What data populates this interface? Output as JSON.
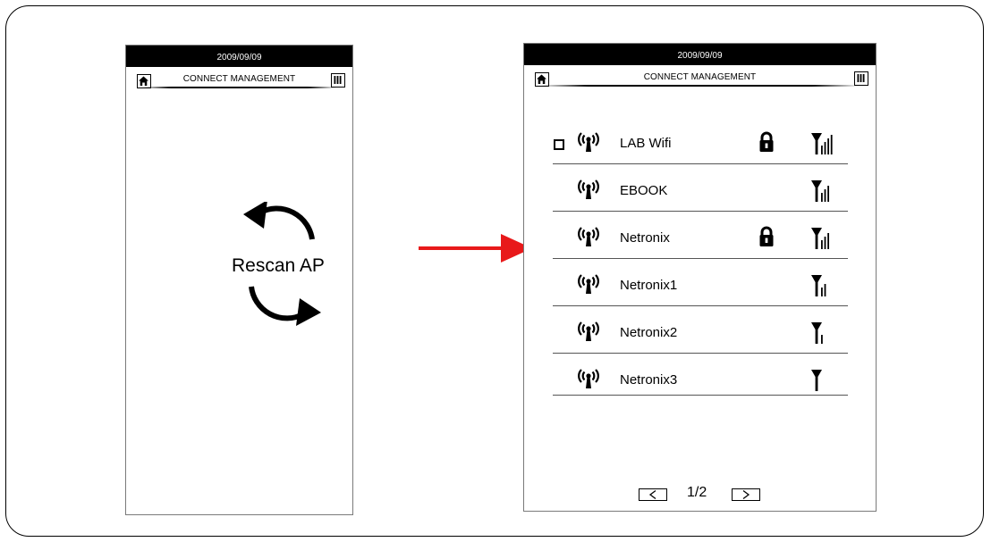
{
  "left_screen": {
    "status": {
      "date": "2009/09/09"
    },
    "header": {
      "title": "CONNECT MANAGEMENT"
    },
    "rescan_label": "Rescan AP",
    "icons": {
      "home": "home-icon",
      "menu": "menu-icon",
      "rescan": "rescan-arrows-icon"
    }
  },
  "right_screen": {
    "status": {
      "date": "2009/09/09"
    },
    "header": {
      "title": "CONNECT MANAGEMENT"
    },
    "networks": [
      {
        "name": "LAB Wifi",
        "secured": true,
        "signal_bars": 4,
        "checkbox": true
      },
      {
        "name": "EBOOK",
        "secured": false,
        "signal_bars": 3,
        "checkbox": false
      },
      {
        "name": "Netronix",
        "secured": true,
        "signal_bars": 3,
        "checkbox": false
      },
      {
        "name": "Netronix1",
        "secured": false,
        "signal_bars": 2,
        "checkbox": false
      },
      {
        "name": "Netronix2",
        "secured": false,
        "signal_bars": 1,
        "checkbox": false
      },
      {
        "name": "Netronix3",
        "secured": false,
        "signal_bars": 0,
        "checkbox": false
      }
    ],
    "pager": {
      "text": "1/2"
    }
  },
  "transition_arrow": {
    "color": "#e8191a"
  }
}
